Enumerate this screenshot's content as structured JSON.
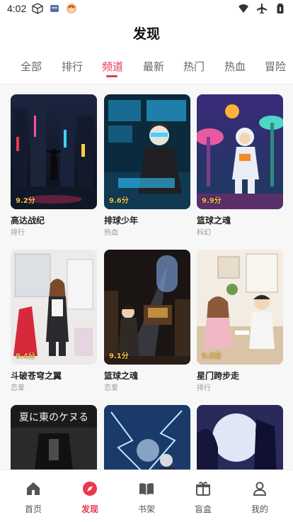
{
  "status_bar": {
    "time": "4:02",
    "icons": [
      "box-icon",
      "app-icon",
      "avatar-icon",
      "wifi-icon",
      "airplane-icon",
      "battery-icon"
    ]
  },
  "header": {
    "title": "发现"
  },
  "tabs": [
    {
      "label": "全部",
      "active": false
    },
    {
      "label": "排行",
      "active": false
    },
    {
      "label": "频道",
      "active": true
    },
    {
      "label": "最新",
      "active": false
    },
    {
      "label": "热门",
      "active": false
    },
    {
      "label": "热血",
      "active": false
    },
    {
      "label": "冒险",
      "active": false
    }
  ],
  "cards": [
    {
      "title": "高达战纪",
      "tag": "排行",
      "score": "9.2分"
    },
    {
      "title": "排球少年",
      "tag": "热血",
      "score": "9.6分"
    },
    {
      "title": "篮球之魂",
      "tag": "科幻",
      "score": "9.9分"
    },
    {
      "title": "斗破苍穹之翼",
      "tag": "恋爱",
      "score": "9.4分"
    },
    {
      "title": "篮球之魂",
      "tag": "恋爱",
      "score": "9.1分"
    },
    {
      "title": "星门跨步走",
      "tag": "排行",
      "score": "9.8分"
    },
    {
      "title": "",
      "tag": "",
      "score": "",
      "cover_text": "夏に東のケヌる"
    },
    {
      "title": "",
      "tag": "",
      "score": ""
    },
    {
      "title": "",
      "tag": "",
      "score": ""
    }
  ],
  "bottom_nav": [
    {
      "label": "首页",
      "icon": "home-icon",
      "active": false
    },
    {
      "label": "发现",
      "icon": "compass-icon",
      "active": true
    },
    {
      "label": "书架",
      "icon": "book-icon",
      "active": false
    },
    {
      "label": "盲盒",
      "icon": "gift-box-icon",
      "active": false
    },
    {
      "label": "我的",
      "icon": "user-icon",
      "active": false
    }
  ],
  "colors": {
    "accent": "#e8384f",
    "score": "#f0c048"
  }
}
